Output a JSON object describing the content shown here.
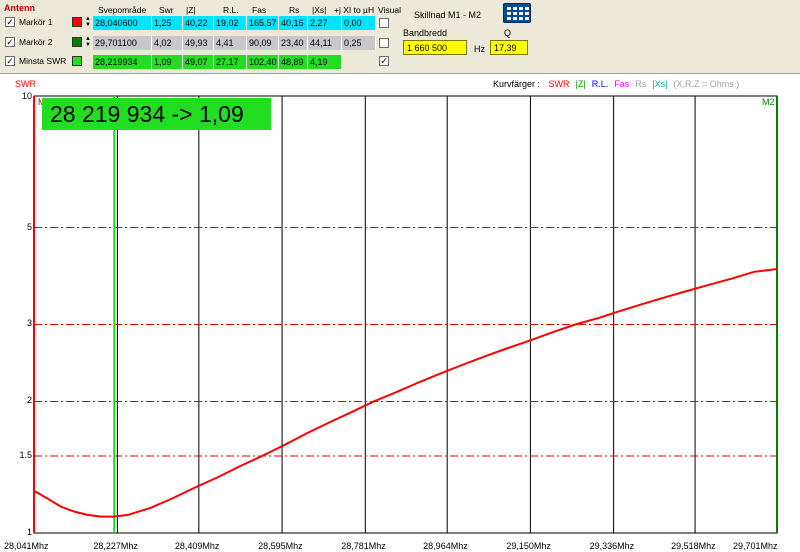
{
  "panel": {
    "title": "Antenn",
    "headers": {
      "sweep": "Svepområde",
      "swr": "Swr",
      "z": "|Z|",
      "rl": "R.L.",
      "phase": "Fas",
      "rs": "Rs",
      "xs": "|Xs|",
      "xl": "+j  XI to µH",
      "visual": "Visual"
    },
    "rows": [
      {
        "label": "Markör 1",
        "color": "#ff0000",
        "checked": "✓",
        "values": [
          "28,040600",
          "1,25",
          "40,22",
          "19,02",
          "165,57",
          "40,16",
          "2,27",
          "0,00"
        ]
      },
      {
        "label": "Markör 2",
        "color": "#008000",
        "checked": "✓",
        "values": [
          "29,701100",
          "4,02",
          "49,93",
          "4,41",
          "90,09",
          "23,40",
          "44,11",
          "0,25"
        ]
      },
      {
        "label": "Minsta SWR",
        "color": "#22dd22",
        "checked": "✓",
        "values": [
          "28,219934",
          "1,09",
          "49,07",
          "27,17",
          "102,40",
          "48,89",
          "4,19",
          ""
        ]
      }
    ],
    "visual_checks": [
      "",
      "",
      "✓"
    ],
    "diff": {
      "title": "Skillnad M1 - M2",
      "bandwidth_label": "Bandbredd",
      "bandwidth_value": "1 660 500",
      "hz_label": "Hz",
      "q_label": "Q",
      "q_value": "17,39"
    }
  },
  "graph": {
    "y_axis_label": "SWR",
    "legend_prefix": "Kurvfärger :",
    "legend_items": [
      {
        "text": "SWR",
        "color": "#ff0000"
      },
      {
        "text": "|Z|",
        "color": "#00a000"
      },
      {
        "text": "R.L.",
        "color": "#0000ff"
      },
      {
        "text": "Fas",
        "color": "#ff00ff"
      },
      {
        "text": "Rs",
        "color": "#a0a0a0"
      },
      {
        "text": "|Xs|",
        "color": "#00a0a0"
      },
      {
        "text": "(X,R,Z = Ohms.)",
        "color": "#a0a0a0"
      }
    ],
    "readout": "28 219 934 -> 1,09",
    "marker1_label": "M1",
    "marker2_label": "M2"
  },
  "chart_data": {
    "type": "line",
    "ylabel": "SWR",
    "y_scale": "log",
    "ylim": [
      1,
      10
    ],
    "yticks": [
      "10",
      "5",
      "3",
      "2",
      "1.5",
      "1"
    ],
    "ytick_values": [
      10,
      5,
      3,
      2,
      1.5,
      1
    ],
    "xlim": [
      28.0406,
      29.7011
    ],
    "xticks": [
      "28,041Mhz",
      "28,227Mhz",
      "28,409Mhz",
      "28,595Mhz",
      "28,781Mhz",
      "28,964Mhz",
      "29,150Mhz",
      "29,336Mhz",
      "29,518Mhz",
      "29,701Mhz"
    ],
    "xtick_values": [
      28.041,
      28.227,
      28.409,
      28.595,
      28.781,
      28.964,
      29.15,
      29.336,
      29.518,
      29.701
    ],
    "markers": [
      {
        "name": "M1",
        "x": 28.0406,
        "color": "#ff0000"
      },
      {
        "name": "M2",
        "x": 29.7011,
        "color": "#008000"
      },
      {
        "name": "min",
        "x": 28.2199,
        "color": "#22dd22"
      }
    ],
    "series": [
      {
        "color": "#ff0000",
        "x": [
          28.0406,
          28.07,
          28.1,
          28.13,
          28.16,
          28.19,
          28.2199,
          28.25,
          28.3,
          28.35,
          28.4,
          28.45,
          28.5,
          28.55,
          28.6,
          28.65,
          28.7,
          28.75,
          28.8,
          28.85,
          28.9,
          28.95,
          29.0,
          29.05,
          29.1,
          29.15,
          29.2,
          29.25,
          29.3,
          29.35,
          29.4,
          29.45,
          29.5,
          29.55,
          29.6,
          29.65,
          29.7011
        ],
        "values": [
          1.25,
          1.2,
          1.15,
          1.12,
          1.1,
          1.09,
          1.09,
          1.1,
          1.14,
          1.2,
          1.27,
          1.34,
          1.42,
          1.5,
          1.59,
          1.69,
          1.79,
          1.89,
          2.0,
          2.1,
          2.21,
          2.32,
          2.43,
          2.54,
          2.65,
          2.76,
          2.88,
          3.0,
          3.1,
          3.22,
          3.34,
          3.46,
          3.58,
          3.7,
          3.82,
          3.96,
          4.02
        ]
      }
    ]
  }
}
